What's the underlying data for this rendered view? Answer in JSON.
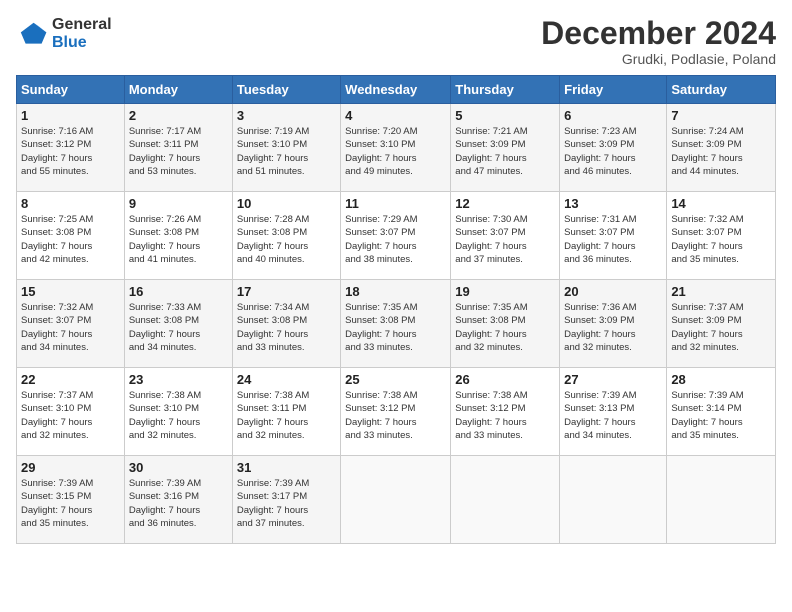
{
  "header": {
    "logo_line1": "General",
    "logo_line2": "Blue",
    "month": "December 2024",
    "location": "Grudki, Podlasie, Poland"
  },
  "weekdays": [
    "Sunday",
    "Monday",
    "Tuesday",
    "Wednesday",
    "Thursday",
    "Friday",
    "Saturday"
  ],
  "weeks": [
    [
      {
        "day": "1",
        "info": "Sunrise: 7:16 AM\nSunset: 3:12 PM\nDaylight: 7 hours\nand 55 minutes."
      },
      {
        "day": "2",
        "info": "Sunrise: 7:17 AM\nSunset: 3:11 PM\nDaylight: 7 hours\nand 53 minutes."
      },
      {
        "day": "3",
        "info": "Sunrise: 7:19 AM\nSunset: 3:10 PM\nDaylight: 7 hours\nand 51 minutes."
      },
      {
        "day": "4",
        "info": "Sunrise: 7:20 AM\nSunset: 3:10 PM\nDaylight: 7 hours\nand 49 minutes."
      },
      {
        "day": "5",
        "info": "Sunrise: 7:21 AM\nSunset: 3:09 PM\nDaylight: 7 hours\nand 47 minutes."
      },
      {
        "day": "6",
        "info": "Sunrise: 7:23 AM\nSunset: 3:09 PM\nDaylight: 7 hours\nand 46 minutes."
      },
      {
        "day": "7",
        "info": "Sunrise: 7:24 AM\nSunset: 3:09 PM\nDaylight: 7 hours\nand 44 minutes."
      }
    ],
    [
      {
        "day": "8",
        "info": "Sunrise: 7:25 AM\nSunset: 3:08 PM\nDaylight: 7 hours\nand 42 minutes."
      },
      {
        "day": "9",
        "info": "Sunrise: 7:26 AM\nSunset: 3:08 PM\nDaylight: 7 hours\nand 41 minutes."
      },
      {
        "day": "10",
        "info": "Sunrise: 7:28 AM\nSunset: 3:08 PM\nDaylight: 7 hours\nand 40 minutes."
      },
      {
        "day": "11",
        "info": "Sunrise: 7:29 AM\nSunset: 3:07 PM\nDaylight: 7 hours\nand 38 minutes."
      },
      {
        "day": "12",
        "info": "Sunrise: 7:30 AM\nSunset: 3:07 PM\nDaylight: 7 hours\nand 37 minutes."
      },
      {
        "day": "13",
        "info": "Sunrise: 7:31 AM\nSunset: 3:07 PM\nDaylight: 7 hours\nand 36 minutes."
      },
      {
        "day": "14",
        "info": "Sunrise: 7:32 AM\nSunset: 3:07 PM\nDaylight: 7 hours\nand 35 minutes."
      }
    ],
    [
      {
        "day": "15",
        "info": "Sunrise: 7:32 AM\nSunset: 3:07 PM\nDaylight: 7 hours\nand 34 minutes."
      },
      {
        "day": "16",
        "info": "Sunrise: 7:33 AM\nSunset: 3:08 PM\nDaylight: 7 hours\nand 34 minutes."
      },
      {
        "day": "17",
        "info": "Sunrise: 7:34 AM\nSunset: 3:08 PM\nDaylight: 7 hours\nand 33 minutes."
      },
      {
        "day": "18",
        "info": "Sunrise: 7:35 AM\nSunset: 3:08 PM\nDaylight: 7 hours\nand 33 minutes."
      },
      {
        "day": "19",
        "info": "Sunrise: 7:35 AM\nSunset: 3:08 PM\nDaylight: 7 hours\nand 32 minutes."
      },
      {
        "day": "20",
        "info": "Sunrise: 7:36 AM\nSunset: 3:09 PM\nDaylight: 7 hours\nand 32 minutes."
      },
      {
        "day": "21",
        "info": "Sunrise: 7:37 AM\nSunset: 3:09 PM\nDaylight: 7 hours\nand 32 minutes."
      }
    ],
    [
      {
        "day": "22",
        "info": "Sunrise: 7:37 AM\nSunset: 3:10 PM\nDaylight: 7 hours\nand 32 minutes."
      },
      {
        "day": "23",
        "info": "Sunrise: 7:38 AM\nSunset: 3:10 PM\nDaylight: 7 hours\nand 32 minutes."
      },
      {
        "day": "24",
        "info": "Sunrise: 7:38 AM\nSunset: 3:11 PM\nDaylight: 7 hours\nand 32 minutes."
      },
      {
        "day": "25",
        "info": "Sunrise: 7:38 AM\nSunset: 3:12 PM\nDaylight: 7 hours\nand 33 minutes."
      },
      {
        "day": "26",
        "info": "Sunrise: 7:38 AM\nSunset: 3:12 PM\nDaylight: 7 hours\nand 33 minutes."
      },
      {
        "day": "27",
        "info": "Sunrise: 7:39 AM\nSunset: 3:13 PM\nDaylight: 7 hours\nand 34 minutes."
      },
      {
        "day": "28",
        "info": "Sunrise: 7:39 AM\nSunset: 3:14 PM\nDaylight: 7 hours\nand 35 minutes."
      }
    ],
    [
      {
        "day": "29",
        "info": "Sunrise: 7:39 AM\nSunset: 3:15 PM\nDaylight: 7 hours\nand 35 minutes."
      },
      {
        "day": "30",
        "info": "Sunrise: 7:39 AM\nSunset: 3:16 PM\nDaylight: 7 hours\nand 36 minutes."
      },
      {
        "day": "31",
        "info": "Sunrise: 7:39 AM\nSunset: 3:17 PM\nDaylight: 7 hours\nand 37 minutes."
      },
      {
        "day": "",
        "info": ""
      },
      {
        "day": "",
        "info": ""
      },
      {
        "day": "",
        "info": ""
      },
      {
        "day": "",
        "info": ""
      }
    ]
  ]
}
